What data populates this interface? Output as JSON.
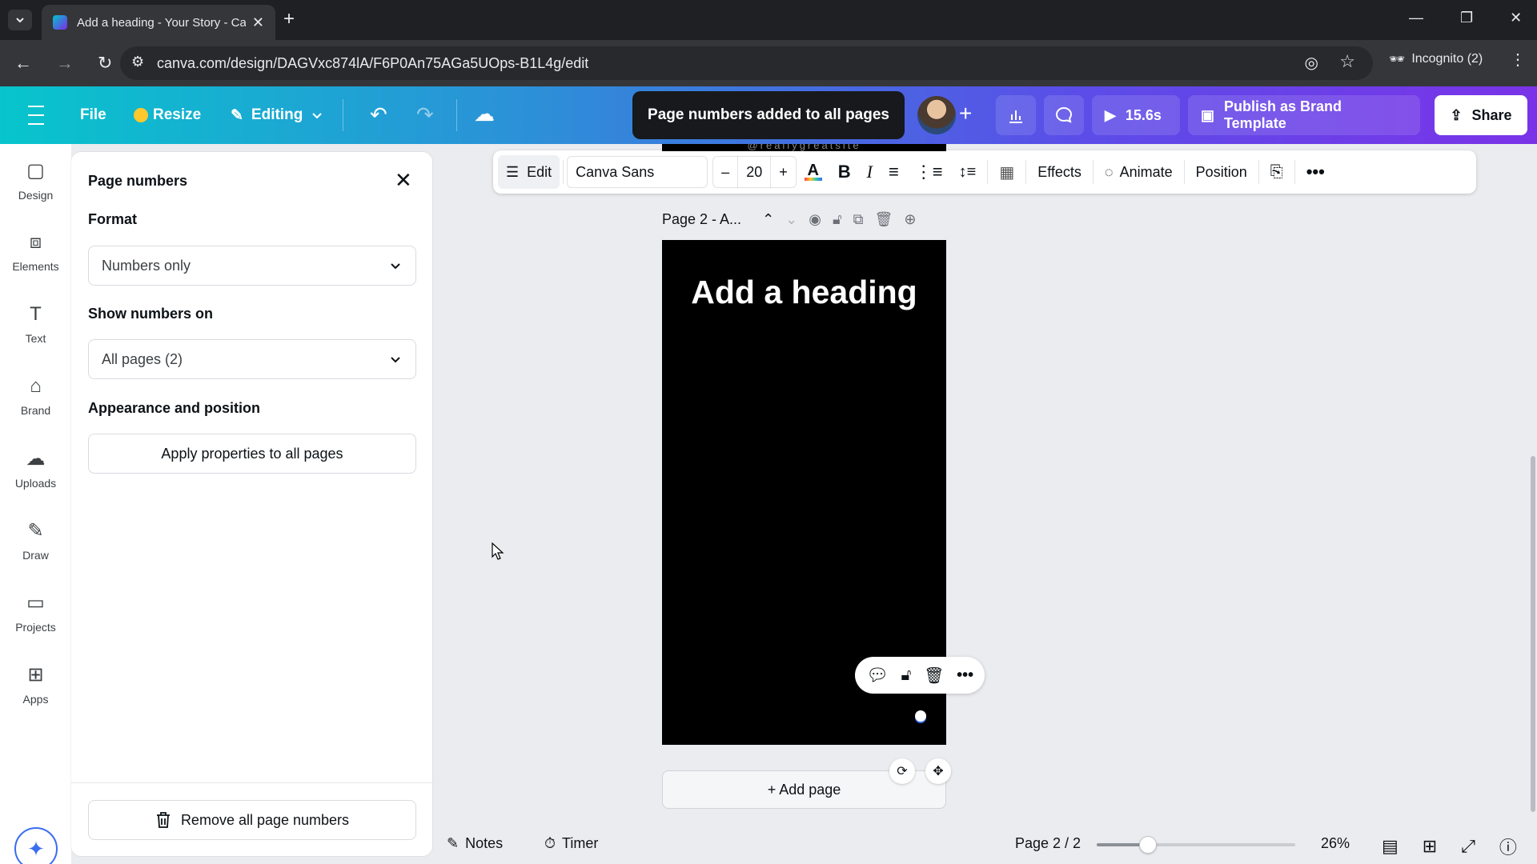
{
  "browser": {
    "tab_title": "Add a heading - Your Story - Ca",
    "url": "canva.com/design/DAGVxc874lA/F6P0An75AGa5UOps-B1L4g/edit",
    "incognito_label": "Incognito (2)"
  },
  "header": {
    "file_label": "File",
    "resize_label": "Resize",
    "editing_label": "Editing",
    "toast": "Page numbers added to all pages",
    "play_time": "15.6s",
    "publish_label": "Publish as Brand Template",
    "share_label": "Share"
  },
  "rail": {
    "items": [
      {
        "label": "Design",
        "icon": "design-icon"
      },
      {
        "label": "Elements",
        "icon": "elements-icon"
      },
      {
        "label": "Text",
        "icon": "text-icon"
      },
      {
        "label": "Brand",
        "icon": "brand-icon"
      },
      {
        "label": "Uploads",
        "icon": "uploads-icon"
      },
      {
        "label": "Draw",
        "icon": "draw-icon"
      },
      {
        "label": "Projects",
        "icon": "projects-icon"
      },
      {
        "label": "Apps",
        "icon": "apps-icon"
      }
    ]
  },
  "panel": {
    "title": "Page numbers",
    "format_label": "Format",
    "format_value": "Numbers only",
    "show_on_label": "Show numbers on",
    "show_on_value": "All pages (2)",
    "appearance_label": "Appearance and position",
    "apply_button": "Apply properties to all pages",
    "remove_button": "Remove all page numbers"
  },
  "toolbar": {
    "edit_label": "Edit",
    "font_name": "Canva Sans",
    "font_size": "20",
    "effects_label": "Effects",
    "animate_label": "Animate",
    "position_label": "Position",
    "text_color": "#ff3d3d"
  },
  "canvas": {
    "page_label": "Page 2 - A...",
    "heading": "Add a heading",
    "top_watermark": "@reallygreatsite",
    "add_page": "+ Add page"
  },
  "footer": {
    "notes_label": "Notes",
    "timer_label": "Timer",
    "page_indicator": "Page 2 / 2",
    "zoom": "26%",
    "zoom_fraction": 0.26
  },
  "colors": {
    "header_gradient_start": "#07c5cc",
    "header_gradient_end": "#7a33e8",
    "page_bg": "#000000"
  }
}
